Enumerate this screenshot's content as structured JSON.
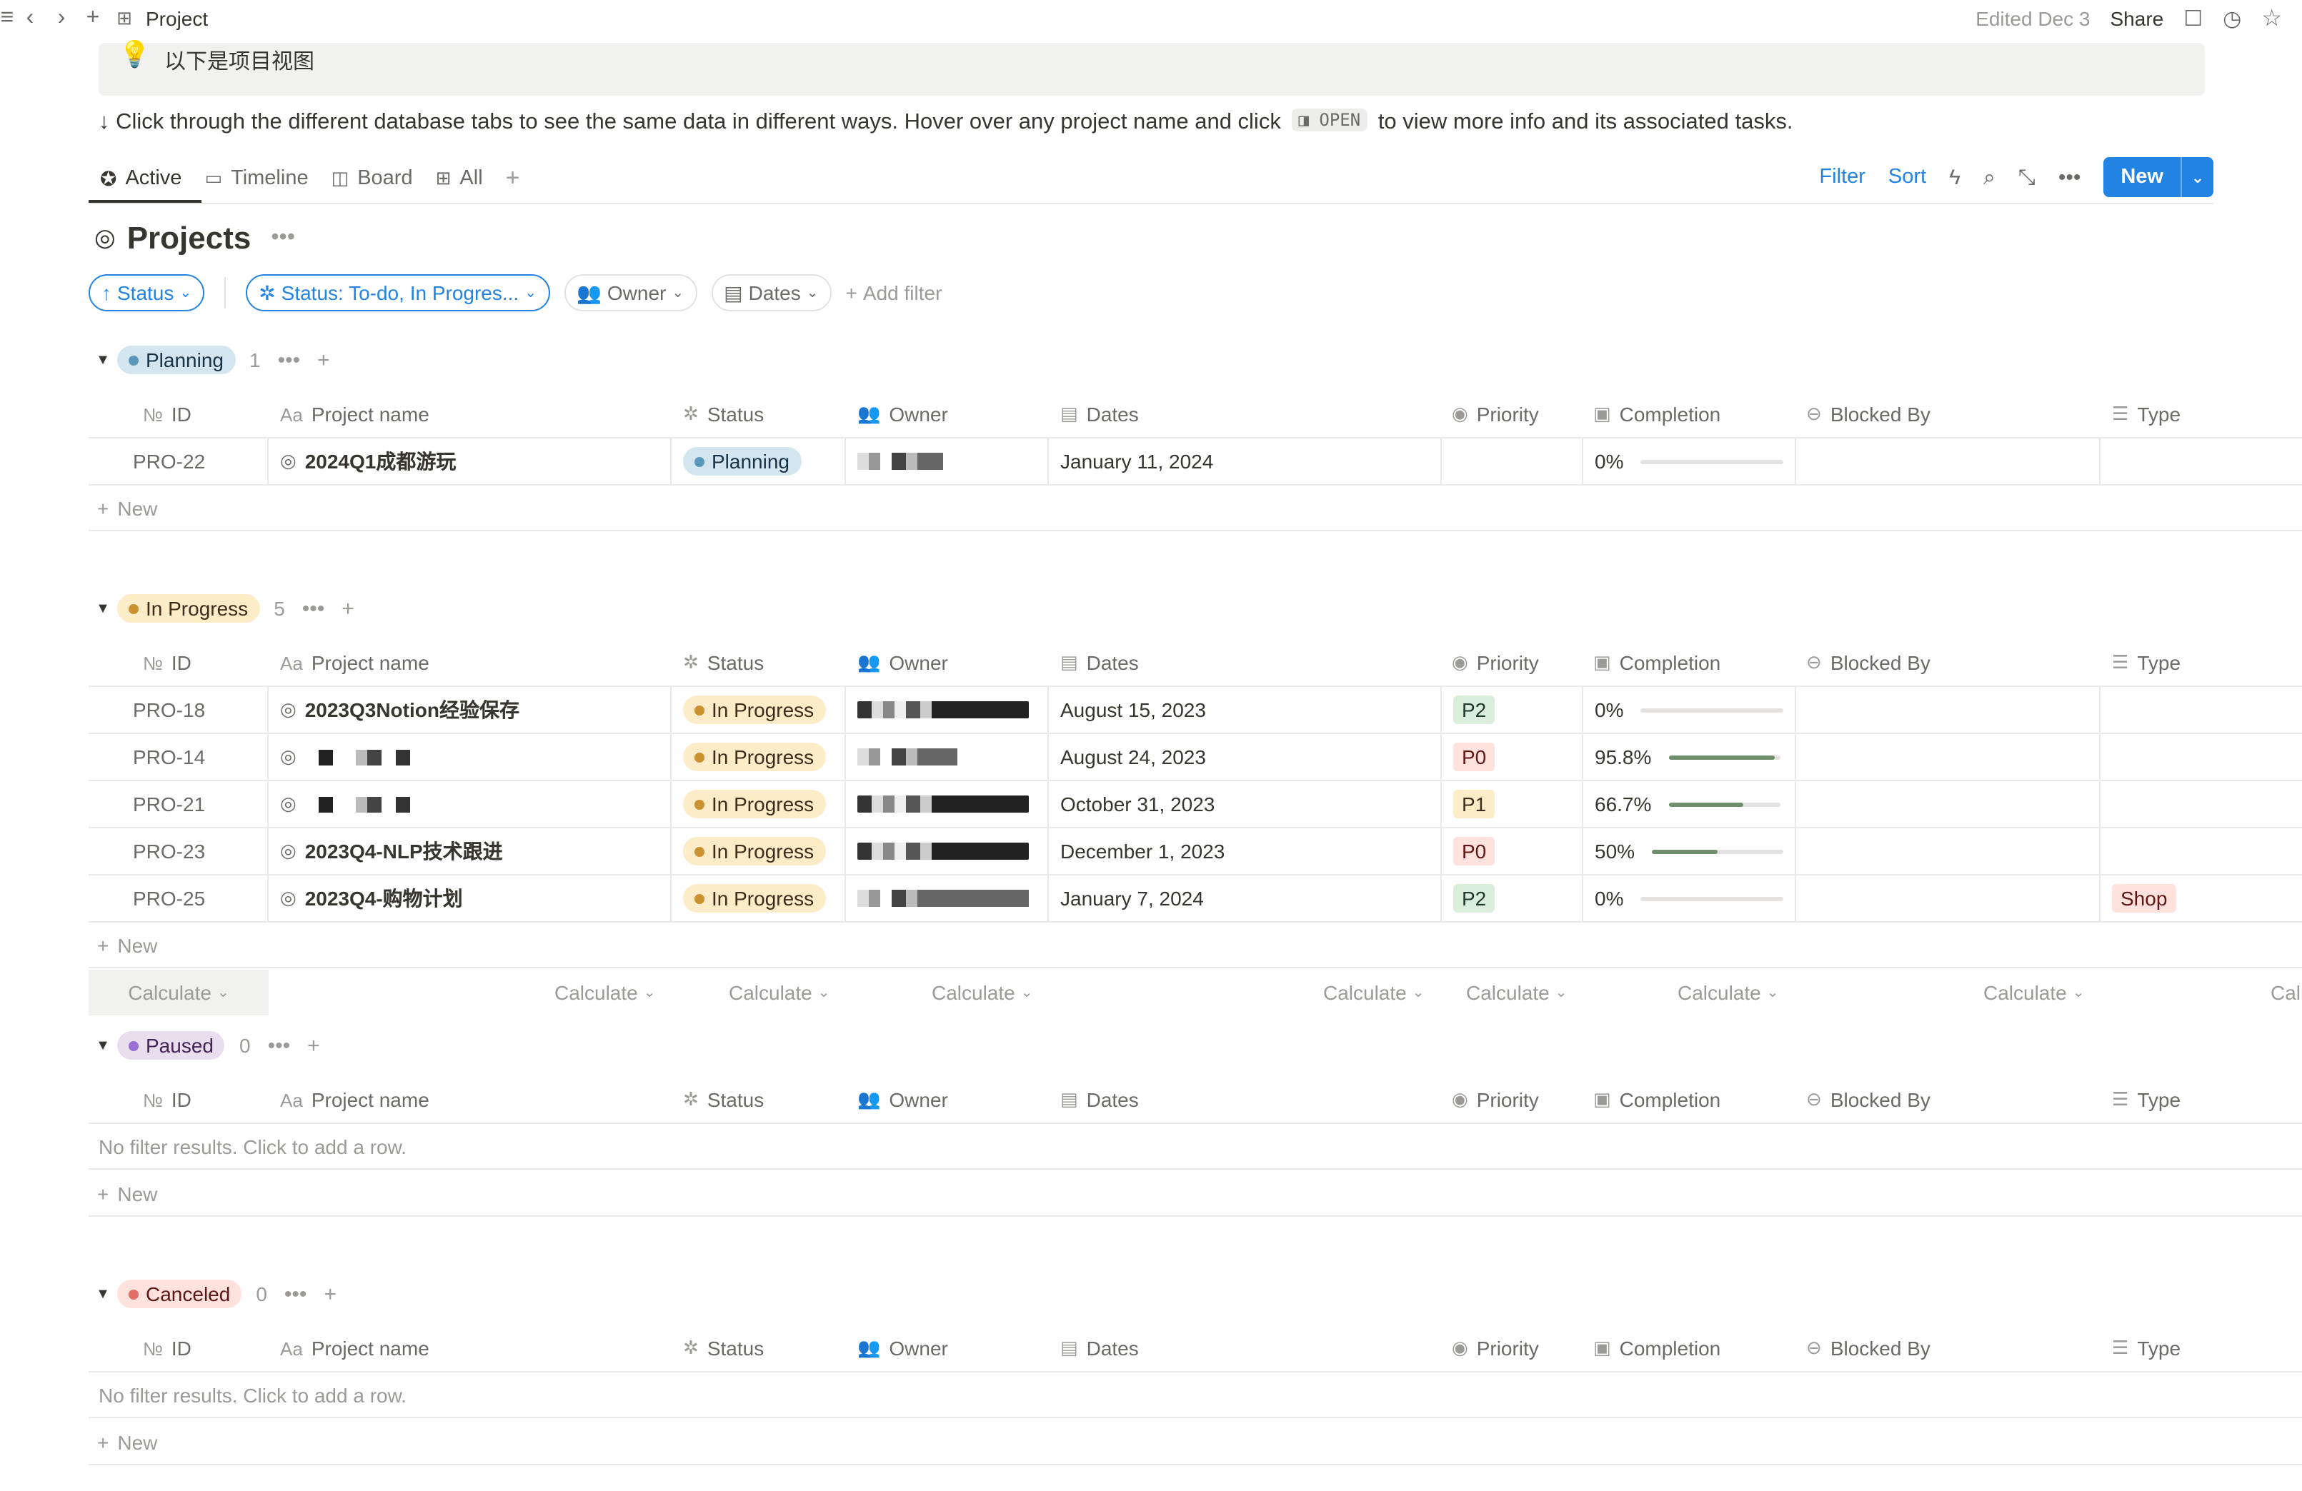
{
  "topbar": {
    "title": "Project",
    "edited": "Edited Dec 3",
    "share": "Share"
  },
  "callout": {
    "icon": "lightbulb-icon",
    "text": "以下是项目视图"
  },
  "hint": {
    "before": "↓ Click through the different database tabs to see the same data in different ways. Hover over any project name and click",
    "code": "OPEN",
    "after": "to view more info and its associated tasks."
  },
  "views": {
    "tabs": [
      {
        "label": "Active",
        "icon": "star-circle-icon"
      },
      {
        "label": "Timeline",
        "icon": "timeline-icon"
      },
      {
        "label": "Board",
        "icon": "board-icon"
      },
      {
        "label": "All",
        "icon": "table-icon"
      }
    ],
    "filter": "Filter",
    "sort": "Sort",
    "new": "New"
  },
  "database": {
    "title": "Projects"
  },
  "filters": {
    "sort_chip": "Status",
    "status_chip": "Status: To-do, In Progres...",
    "owner_chip": "Owner",
    "dates_chip": "Dates",
    "add_filter": "Add filter"
  },
  "columns": {
    "id": "ID",
    "id_icon": "№",
    "name": "Project name",
    "name_icon": "Aa",
    "status": "Status",
    "owner": "Owner",
    "dates": "Dates",
    "priority": "Priority",
    "completion": "Completion",
    "blocked": "Blocked By",
    "type": "Type"
  },
  "labels": {
    "new_row": "New",
    "no_results": "No filter results. Click to add a row.",
    "calculate": "Calculate",
    "calculate_cut": "Cal"
  },
  "colors": {
    "accent": "#2383e2",
    "planning_bg": "#d3e5ef",
    "planning_dot": "#5b97bd",
    "progress_bg": "#fdecc8",
    "progress_dot": "#cb912f",
    "paused_bg": "#e8deee",
    "paused_dot": "#9a6dd7",
    "canceled_bg": "#ffe2dd",
    "canceled_dot": "#e16f64",
    "p0_bg": "#ffe2dd",
    "p1_bg": "#fdecc8",
    "p2_bg": "#dbeddb"
  },
  "groups": {
    "planning": {
      "label": "Planning",
      "count": "1",
      "rows": [
        {
          "id": "PRO-22",
          "name": "2024Q1成都游玩",
          "status": "Planning",
          "date": "January 11, 2024",
          "priority": "",
          "completion": "0%",
          "completion_value": 0,
          "type": ""
        }
      ]
    },
    "inprogress": {
      "label": "In Progress",
      "count": "5",
      "rows": [
        {
          "id": "PRO-18",
          "name": "2023Q3Notion经验保存",
          "status": "In Progress",
          "date": "August 15, 2023",
          "priority": "P2",
          "completion": "0%",
          "completion_value": 0,
          "type": ""
        },
        {
          "id": "PRO-14",
          "name": "",
          "status": "In Progress",
          "date": "August 24, 2023",
          "priority": "P0",
          "completion": "95.8%",
          "completion_value": 0.958,
          "type": ""
        },
        {
          "id": "PRO-21",
          "name": "",
          "status": "In Progress",
          "date": "October 31, 2023",
          "priority": "P1",
          "completion": "66.7%",
          "completion_value": 0.667,
          "type": ""
        },
        {
          "id": "PRO-23",
          "name": "2023Q4-NLP技术跟进",
          "status": "In Progress",
          "date": "December 1, 2023",
          "priority": "P0",
          "completion": "50%",
          "completion_value": 0.5,
          "type": ""
        },
        {
          "id": "PRO-25",
          "name": "2023Q4-购物计划",
          "status": "In Progress",
          "date": "January 7, 2024",
          "priority": "P2",
          "completion": "0%",
          "completion_value": 0,
          "type": "Shop"
        }
      ]
    },
    "paused": {
      "label": "Paused",
      "count": "0"
    },
    "canceled": {
      "label": "Canceled",
      "count": "0"
    }
  }
}
